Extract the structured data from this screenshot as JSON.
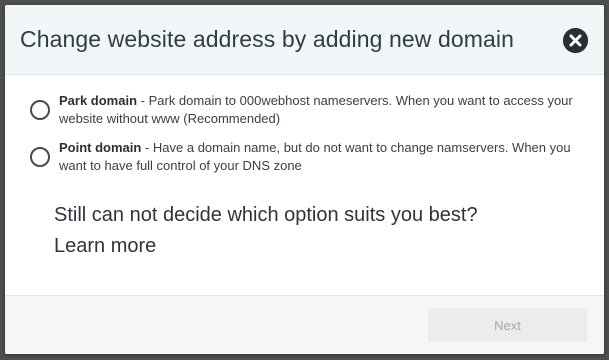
{
  "modal": {
    "title": "Change website address by adding new domain",
    "close_icon": "close-circle-icon"
  },
  "options": [
    {
      "name": "Park domain",
      "description": " - Park domain to 000webhost nameservers. When you want to access your website without www (Recommended)",
      "selected": false
    },
    {
      "name": "Point domain",
      "description": " - Have a domain name, but do not want to change namservers. When you want to have full control of your DNS zone",
      "selected": false
    }
  ],
  "help": {
    "text": "Still can not decide which option suits you best? ",
    "link": "Learn more"
  },
  "footer": {
    "next_label": "Next",
    "next_disabled": true
  },
  "colors": {
    "header_bg": "#f1f7f8",
    "backdrop": "#4f4f4f",
    "disabled_button_bg": "#ececec",
    "disabled_button_text": "#a8a8a8"
  }
}
